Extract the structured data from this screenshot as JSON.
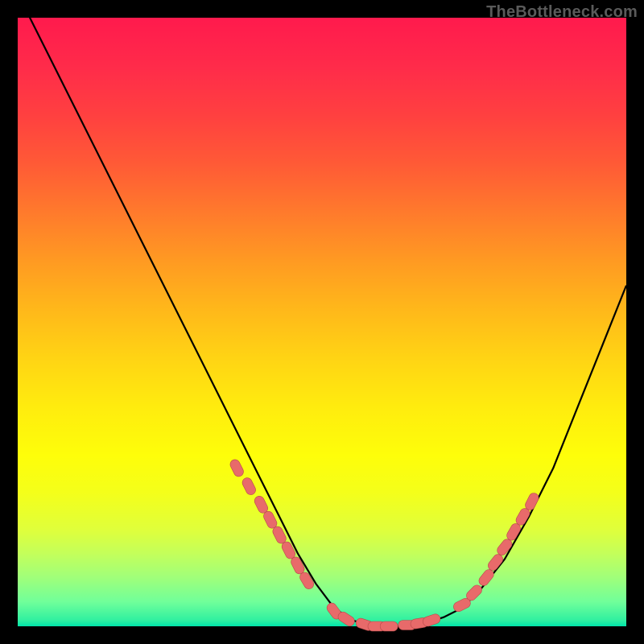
{
  "watermark": "TheBottleneck.com",
  "chart_data": {
    "type": "line",
    "title": "",
    "xlabel": "",
    "ylabel": "",
    "xlim": [
      0,
      100
    ],
    "ylim": [
      0,
      100
    ],
    "background_gradient": {
      "top": "#ff1a4d",
      "bottom": "#00e4aa"
    },
    "series": [
      {
        "name": "bottleneck-curve",
        "x": [
          0,
          5,
          10,
          15,
          20,
          25,
          28,
          31,
          34,
          37,
          40,
          43,
          46,
          49,
          52,
          55,
          58,
          61,
          64,
          67,
          70,
          73,
          76,
          80,
          84,
          88,
          92,
          96,
          100
        ],
        "y": [
          104,
          94,
          84,
          74,
          64,
          54,
          48,
          42,
          36,
          30,
          24,
          18,
          12,
          7,
          3,
          1,
          0,
          0,
          0,
          0.5,
          1.5,
          3,
          6,
          11,
          18,
          26,
          36,
          46,
          56
        ]
      }
    ],
    "markers": {
      "name": "highlighted-points",
      "points": [
        {
          "x": 36,
          "y": 26
        },
        {
          "x": 38,
          "y": 23
        },
        {
          "x": 40,
          "y": 20
        },
        {
          "x": 41.5,
          "y": 17.5
        },
        {
          "x": 43,
          "y": 15
        },
        {
          "x": 44.5,
          "y": 12.5
        },
        {
          "x": 46,
          "y": 10
        },
        {
          "x": 47.5,
          "y": 7.5
        },
        {
          "x": 52,
          "y": 2.5
        },
        {
          "x": 54,
          "y": 1.2
        },
        {
          "x": 57,
          "y": 0.3
        },
        {
          "x": 59,
          "y": 0
        },
        {
          "x": 61,
          "y": 0
        },
        {
          "x": 64,
          "y": 0.2
        },
        {
          "x": 66,
          "y": 0.5
        },
        {
          "x": 68,
          "y": 1
        },
        {
          "x": 73,
          "y": 3.5
        },
        {
          "x": 75,
          "y": 5.5
        },
        {
          "x": 77,
          "y": 8
        },
        {
          "x": 78.5,
          "y": 10.5
        },
        {
          "x": 80,
          "y": 13
        },
        {
          "x": 81.5,
          "y": 15.5
        },
        {
          "x": 83,
          "y": 18
        },
        {
          "x": 84.5,
          "y": 20.5
        }
      ]
    }
  }
}
